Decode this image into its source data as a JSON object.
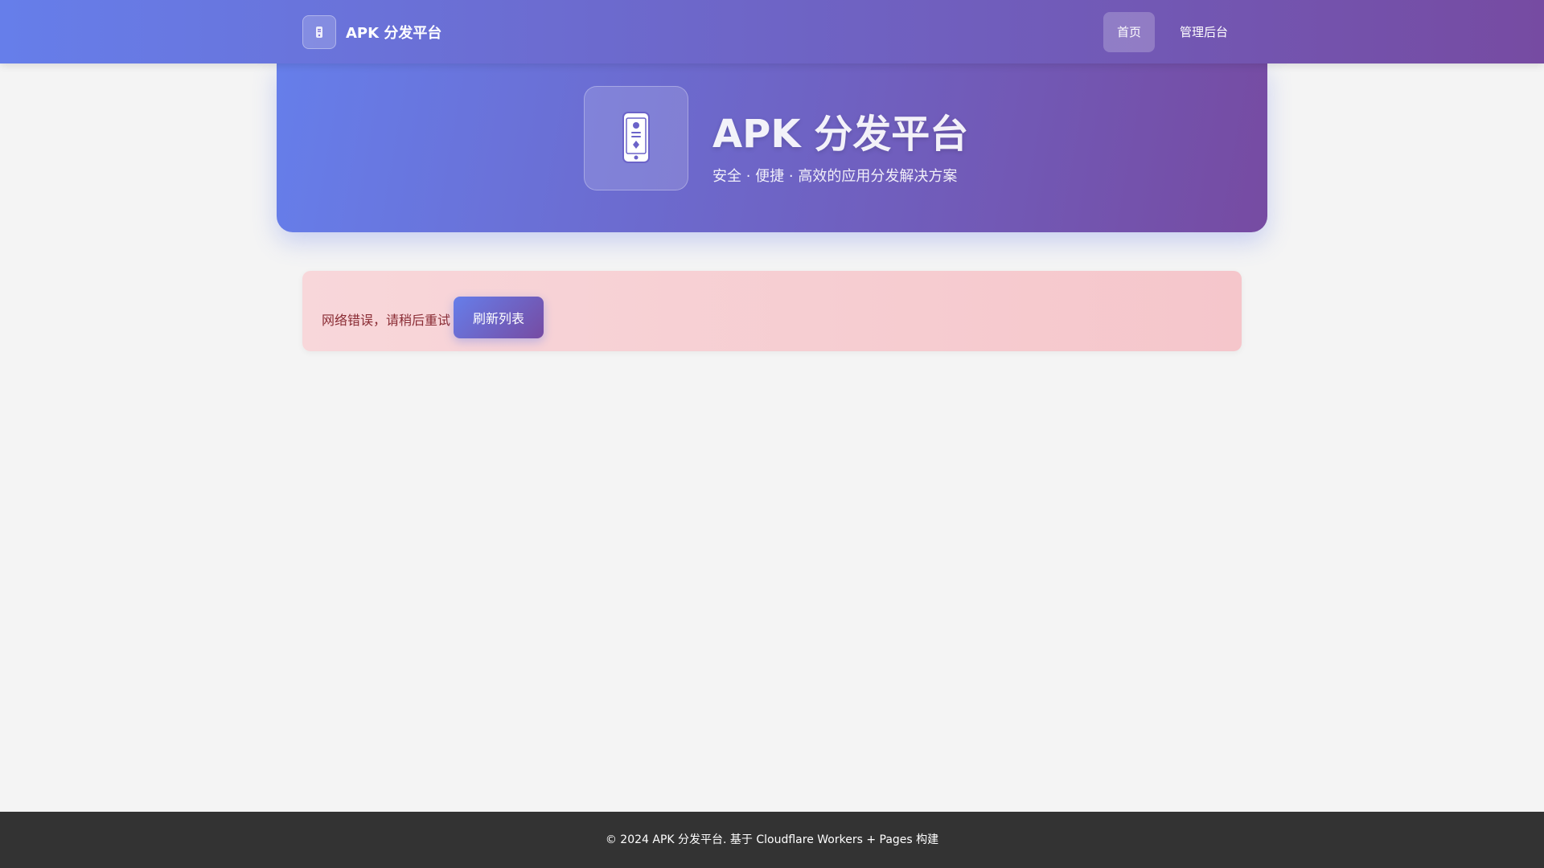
{
  "nav": {
    "brand_name": "APK 分发平台",
    "brand_icon": "phone-icon",
    "links": [
      {
        "label": "首页",
        "active": true
      },
      {
        "label": "管理后台",
        "active": false
      }
    ]
  },
  "hero": {
    "icon": "phone-icon",
    "title": "APK 分发平台",
    "subtitle": "安全 · 便捷 · 高效的应用分发解决方案"
  },
  "alert": {
    "message": "网络错误，请稍后重试",
    "button_label": "刷新列表"
  },
  "footer": {
    "text": "© 2024 APK 分发平台. 基于 Cloudflare Workers + Pages 构建"
  },
  "colors": {
    "gradient_start": "#667eea",
    "gradient_end": "#764ba2",
    "alert_bg": "#f8d7da",
    "alert_text": "#8a2c34",
    "footer_bg": "#333333",
    "page_bg": "#f4f4f4"
  }
}
